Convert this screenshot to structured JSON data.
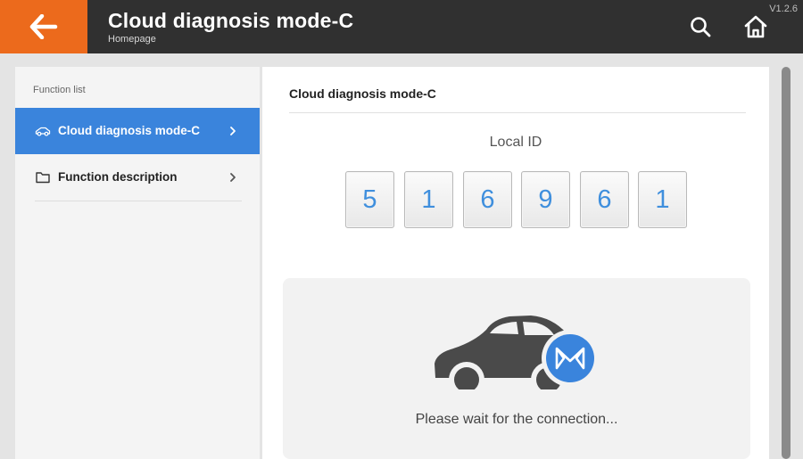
{
  "header": {
    "title": "Cloud diagnosis mode-C",
    "subtitle": "Homepage",
    "version": "V1.2.6",
    "icons": {
      "back": "arrow-left-icon",
      "search": "search-icon",
      "home": "home-icon"
    }
  },
  "sidebar": {
    "header": "Function list",
    "items": [
      {
        "label": "Cloud diagnosis mode-C",
        "icon": "car-icon",
        "active": true
      },
      {
        "label": "Function description",
        "icon": "folder-icon",
        "active": false
      }
    ]
  },
  "main": {
    "title": "Cloud diagnosis mode-C",
    "local_id_label": "Local ID",
    "local_id_digits": [
      "5",
      "1",
      "6",
      "9",
      "6",
      "1"
    ],
    "connection_text": "Please wait for the connection...",
    "connection_icon": "car-connection-icon"
  },
  "colors": {
    "accent_orange": "#ec6a1c",
    "accent_blue": "#3a84dc",
    "digit_blue": "#3f8fdd",
    "topbar": "#303030"
  }
}
